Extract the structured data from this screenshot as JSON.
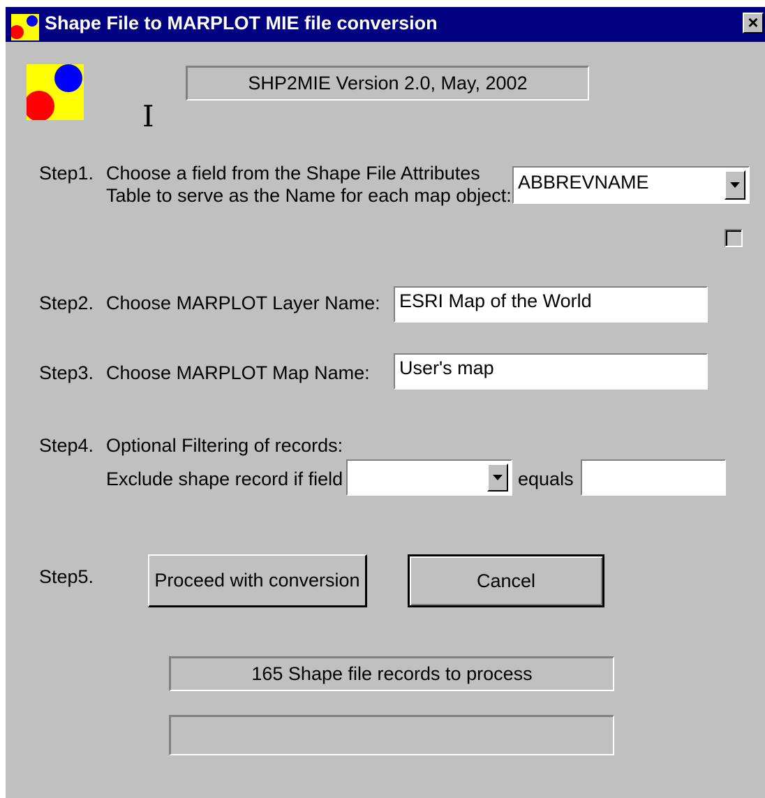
{
  "window": {
    "title": "Shape File to MARPLOT MIE file conversion",
    "close_label": "×"
  },
  "header": {
    "version": "SHP2MIE  Version 2.0,  May, 2002"
  },
  "steps": {
    "step1": {
      "label": "Step1.",
      "text_line1": "Choose a field from the Shape File Attributes",
      "text_line2": "Table to serve as the Name for each map object:",
      "selected": "ABBREVNAME"
    },
    "step2": {
      "label": "Step2.",
      "text": "Choose MARPLOT Layer Name:",
      "value": "ESRI Map of the World"
    },
    "step3": {
      "label": "Step3.",
      "text": "Choose MARPLOT Map Name:",
      "value": "User's map"
    },
    "step4": {
      "label": "Step4.",
      "text_line1": "Optional Filtering of records:",
      "text_line2": "Exclude shape record if field",
      "field_value": "",
      "equals_label": "equals",
      "equals_value": ""
    },
    "step5": {
      "label": "Step5.",
      "proceed_label": "Proceed with conversion",
      "cancel_label": "Cancel"
    }
  },
  "status": {
    "records_text": "165 Shape file records to process",
    "progress": 0
  }
}
